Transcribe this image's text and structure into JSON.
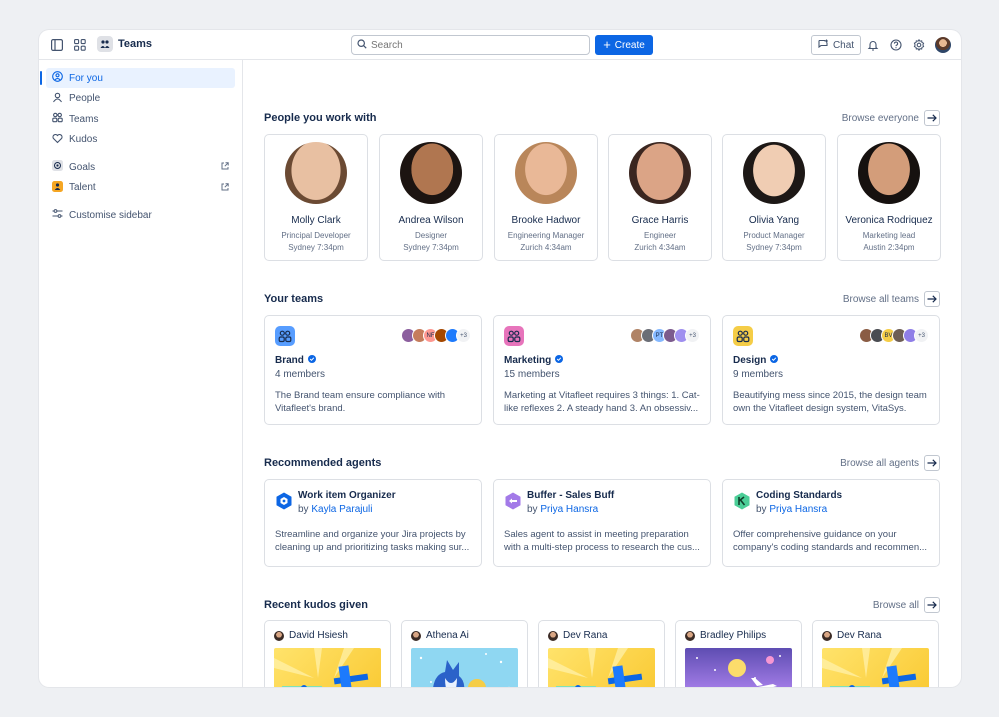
{
  "topbar": {
    "app_name": "Teams",
    "search_placeholder": "Search",
    "create_label": "Create",
    "chat_label": "Chat"
  },
  "sidebar": {
    "items": [
      {
        "label": "For you",
        "icon": "person-circle-icon",
        "active": true
      },
      {
        "label": "People",
        "icon": "person-icon"
      },
      {
        "label": "Teams",
        "icon": "people-group-icon"
      },
      {
        "label": "Kudos",
        "icon": "heart-icon"
      },
      {
        "label": "Goals",
        "icon": "goal-icon",
        "external": true
      },
      {
        "label": "Talent",
        "icon": "talent-icon",
        "external": true
      },
      {
        "label": "Customise sidebar",
        "icon": "sliders-icon"
      }
    ]
  },
  "people": {
    "title": "People you work with",
    "browse": "Browse everyone",
    "list": [
      {
        "name": "Molly Clark",
        "role": "Principal Developer",
        "location": "Sydney 7:34pm"
      },
      {
        "name": "Andrea Wilson",
        "role": "Designer",
        "location": "Sydney 7:34pm"
      },
      {
        "name": "Brooke Hadwor",
        "role": "Engineering Manager",
        "location": "Zurich 4:34am"
      },
      {
        "name": "Grace Harris",
        "role": "Engineer",
        "location": "Zurich 4:34am"
      },
      {
        "name": "Olivia Yang",
        "role": "Product Manager",
        "location": "Sydney 7:34pm"
      },
      {
        "name": "Veronica Rodriquez",
        "role": "Marketing lead",
        "location": "Austin 2:34pm"
      }
    ]
  },
  "teams": {
    "title": "Your teams",
    "browse": "Browse all teams",
    "list": [
      {
        "name": "Brand",
        "members": "4 members",
        "description": "The Brand team ensure compliance with Vitafleet's brand.",
        "more": "+3",
        "avatar_text": [
          "",
          "",
          "NF",
          "",
          ""
        ]
      },
      {
        "name": "Marketing",
        "members": "15 members",
        "description": "Marketing at Vitafleet requires 3 things: 1. Cat-like reflexes 2. A steady hand  3. An obsessiv...",
        "more": "+3",
        "avatar_text": [
          "",
          "",
          "PT",
          "",
          ""
        ]
      },
      {
        "name": "Design",
        "members": "9 members",
        "description": "Beautifying mess since 2015, the design team own the Vitafleet design system, VitaSys.",
        "more": "+3",
        "avatar_text": [
          "",
          "",
          "BV",
          "",
          ""
        ]
      }
    ]
  },
  "agents": {
    "title": "Recommended agents",
    "browse": "Browse all agents",
    "by_prefix": "by",
    "list": [
      {
        "name": "Work item Organizer",
        "author": "Kayla Parajuli",
        "description": "Streamline and organize your Jira projects by cleaning up and prioritizing tasks making sur..."
      },
      {
        "name": "Buffer - Sales Buff",
        "author": "Priya Hansra",
        "description": "Sales agent to assist in meeting preparation with a multi-step process to research the cus..."
      },
      {
        "name": "Coding Standards",
        "author": "Priya Hansra",
        "description": "Offer comprehensive guidance on your company's coding standards and recommen..."
      }
    ]
  },
  "kudos": {
    "title": "Recent kudos given",
    "browse": "Browse all",
    "list": [
      {
        "name": "David Hsiesh",
        "image": "hammer"
      },
      {
        "name": "Athena Ai",
        "image": "dog"
      },
      {
        "name": "Dev Rana",
        "image": "hammer"
      },
      {
        "name": "Bradley Philips",
        "image": "space"
      },
      {
        "name": "Dev Rana",
        "image": "hammer"
      }
    ]
  },
  "colors": {
    "accent": "#0c66e4",
    "brand_team": "#579dff",
    "marketing_team": "#e774bb",
    "design_team": "#f5cd47"
  }
}
